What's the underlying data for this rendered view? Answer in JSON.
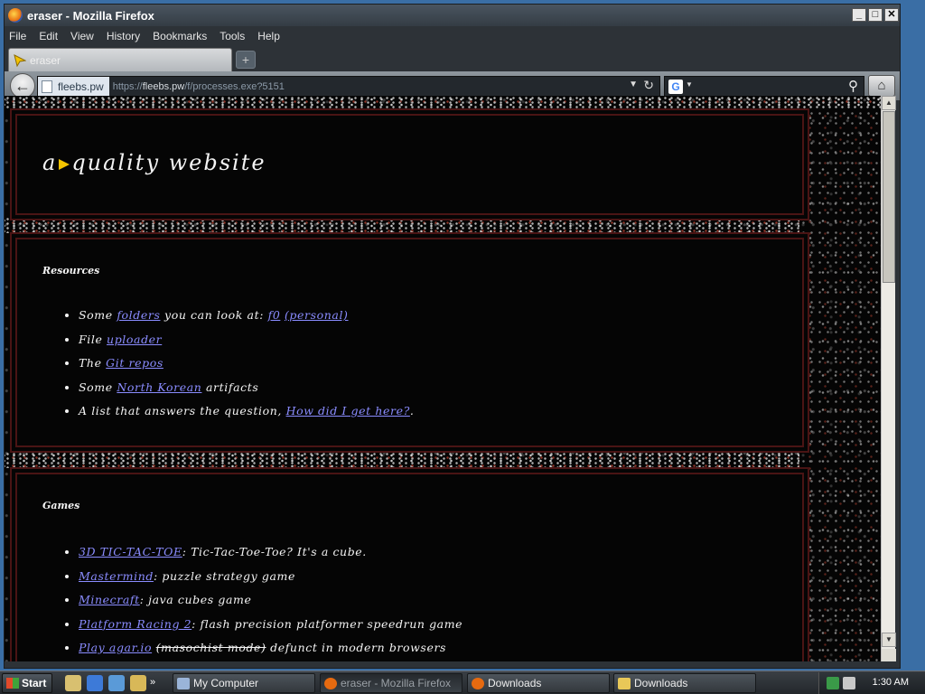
{
  "window": {
    "title": "eraser - Mozilla Firefox",
    "controls": {
      "minimize": "_",
      "maximize": "□",
      "close": "✕"
    }
  },
  "menubar": [
    {
      "label": "File"
    },
    {
      "label": "Edit"
    },
    {
      "label": "View"
    },
    {
      "label": "History"
    },
    {
      "label": "Bookmarks"
    },
    {
      "label": "Tools"
    },
    {
      "label": "Help"
    }
  ],
  "tab": {
    "label": "eraser",
    "icon": "yellow-cursor-icon"
  },
  "newtab": {
    "symbol": "+"
  },
  "navbar": {
    "back_symbol": "←",
    "identity": "fleebs.pw",
    "url_prefix": "https://",
    "url_host": "fleebs.pw",
    "url_path": "/f/processes.exe?5151",
    "dropdown_symbol": "▼",
    "reload_symbol": "↻",
    "search_engine_icon": "G",
    "search_dropdown_symbol": "▼",
    "search_symbol": "⚲",
    "home_symbol": "⌂"
  },
  "page": {
    "title_a": "a",
    "title_b": "quality website",
    "resources": {
      "heading": "Resources",
      "items": [
        {
          "pre": "Some ",
          "link1": "folders",
          "mid": " you can look at: ",
          "link2": "f0",
          "mid2": " ",
          "link3": "(personal)",
          "post": ""
        },
        {
          "pre": "File ",
          "link1": "uploader",
          "post": ""
        },
        {
          "pre": "The ",
          "link1": "Git repos",
          "post": ""
        },
        {
          "pre": "Some ",
          "link1": "North Korean",
          "post": " artifacts"
        },
        {
          "pre": "A list that answers the question, ",
          "link1": "How did I get here?",
          "post": "."
        }
      ]
    },
    "games": {
      "heading": "Games",
      "items": [
        {
          "link": "3D TIC-TAC-TOE",
          "post": ": Tic-Tac-Toe-Toe? It's a cube."
        },
        {
          "link": "Mastermind",
          "post": ": puzzle strategy game"
        },
        {
          "link": "Minecraft",
          "post": ": java cubes game"
        },
        {
          "link": "Platform Racing 2",
          "post": ": flash precision platformer speedrun game"
        },
        {
          "link": "Play agar.io",
          "strike": "(masochist mode)",
          "post": " defunct in modern browsers"
        }
      ]
    }
  },
  "scrollbar": {
    "up": "▲",
    "down": "▼"
  },
  "taskbar": {
    "start": "Start",
    "overflow": "»",
    "buttons": [
      {
        "label": "My Computer",
        "icon": "computer-icon"
      },
      {
        "label": "eraser - Mozilla Firefox",
        "icon": "firefox-icon",
        "active": true
      },
      {
        "label": "Downloads",
        "icon": "firefox-downloads-icon"
      },
      {
        "label": "Downloads",
        "icon": "folder-icon"
      }
    ],
    "clock": "1:30 AM"
  },
  "colors": {
    "link": "#8a8cff",
    "box_border": "#4a1414",
    "page_bg": "#050505",
    "chrome": "#2d3237"
  }
}
